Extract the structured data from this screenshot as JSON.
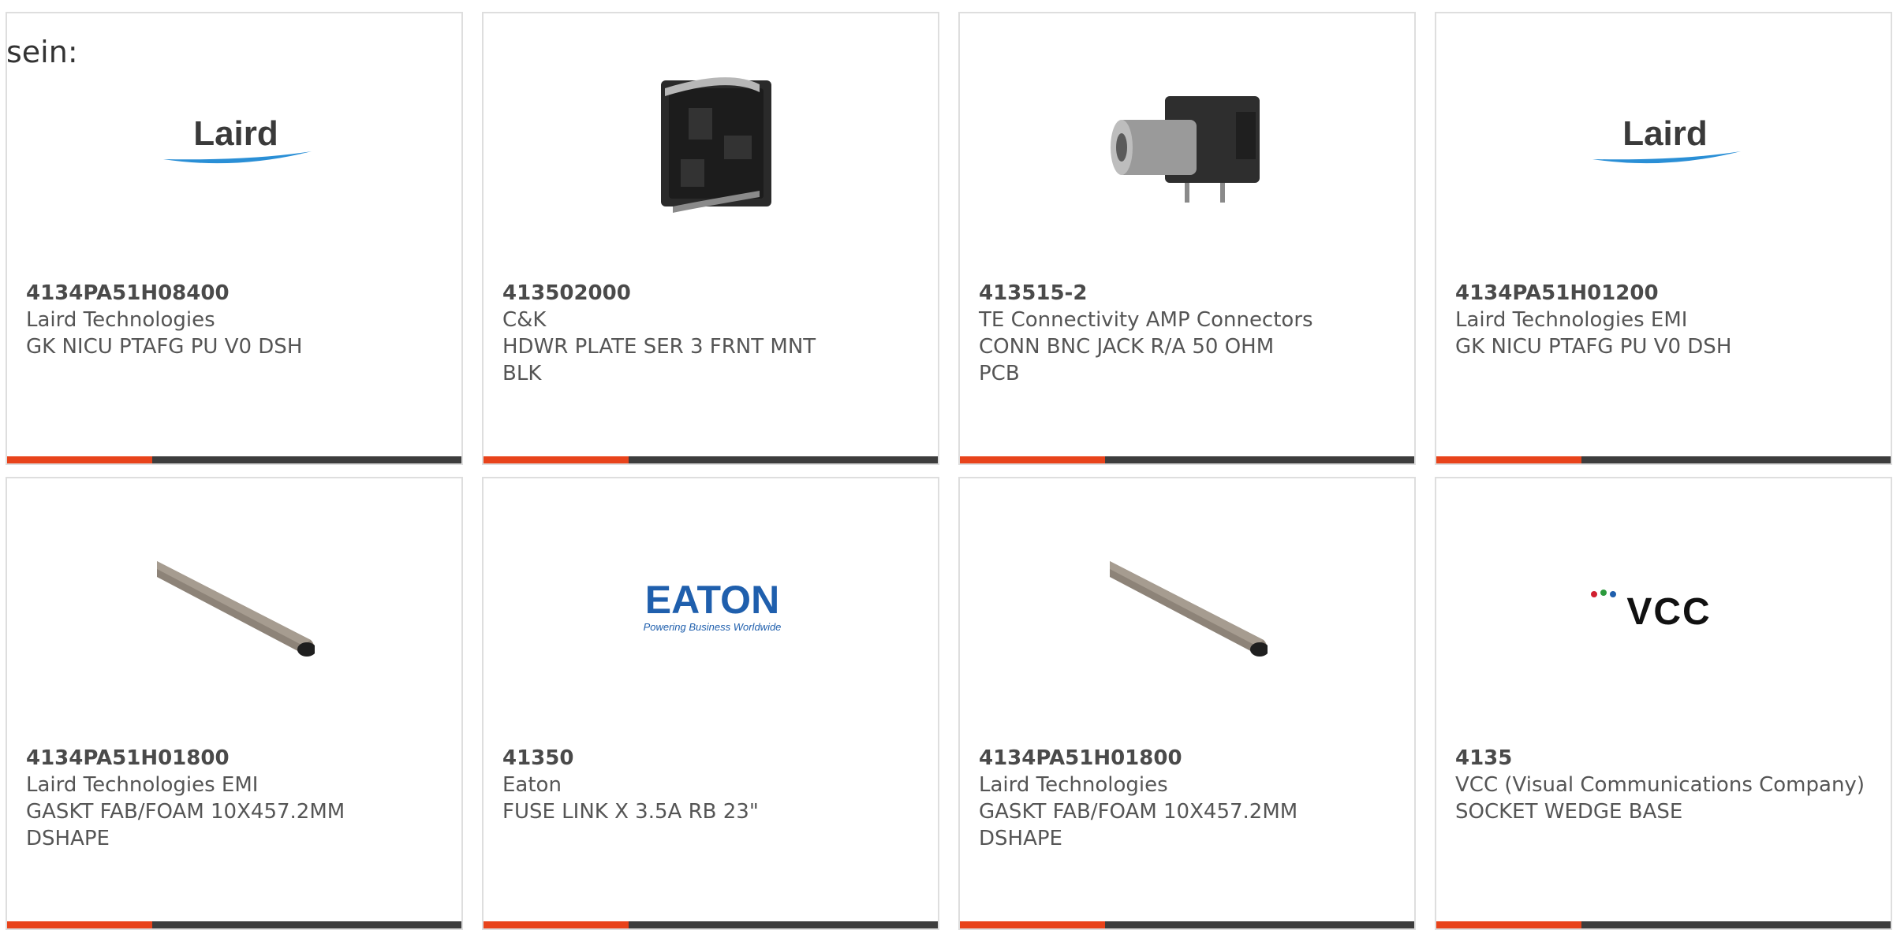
{
  "intro_text": "sein:",
  "colors": {
    "accent": "#e8431b",
    "bar": "#3d3d3d",
    "border": "#dedede",
    "text": "#555555"
  },
  "cards": [
    {
      "part": "4134PA51H08400",
      "maker": "Laird Technologies",
      "desc": "GK NICU PTAFG PU V0 DSH",
      "image": "laird-logo",
      "logo_text": "Laird"
    },
    {
      "part": "413502000",
      "maker": "C&K",
      "desc": "HDWR PLATE SER 3 FRNT MNT BLK",
      "image": "hardware-plate-photo"
    },
    {
      "part": "413515-2",
      "maker": "TE Connectivity AMP Connectors",
      "desc": "CONN BNC JACK R/A 50 OHM PCB",
      "image": "bnc-connector-photo"
    },
    {
      "part": "4134PA51H01200",
      "maker": "Laird Technologies EMI",
      "desc": "GK NICU PTAFG PU V0 DSH",
      "image": "laird-logo",
      "logo_text": "Laird"
    },
    {
      "part": "4134PA51H01800",
      "maker": "Laird Technologies EMI",
      "desc": "GASKT FAB/FOAM 10X457.2MM DSHAPE",
      "image": "gasket-strip-photo"
    },
    {
      "part": "41350",
      "maker": "Eaton",
      "desc": "FUSE LINK X 3.5A RB 23\"",
      "image": "eaton-logo",
      "logo_text": "EATON",
      "logo_tagline": "Powering Business Worldwide"
    },
    {
      "part": "4134PA51H01800",
      "maker": "Laird Technologies",
      "desc": "GASKT FAB/FOAM 10X457.2MM DSHAPE",
      "image": "gasket-strip-photo"
    },
    {
      "part": "4135",
      "maker": "VCC (Visual Communications Company)",
      "desc": "SOCKET WEDGE BASE",
      "image": "vcc-logo",
      "logo_text": "VCC"
    }
  ]
}
